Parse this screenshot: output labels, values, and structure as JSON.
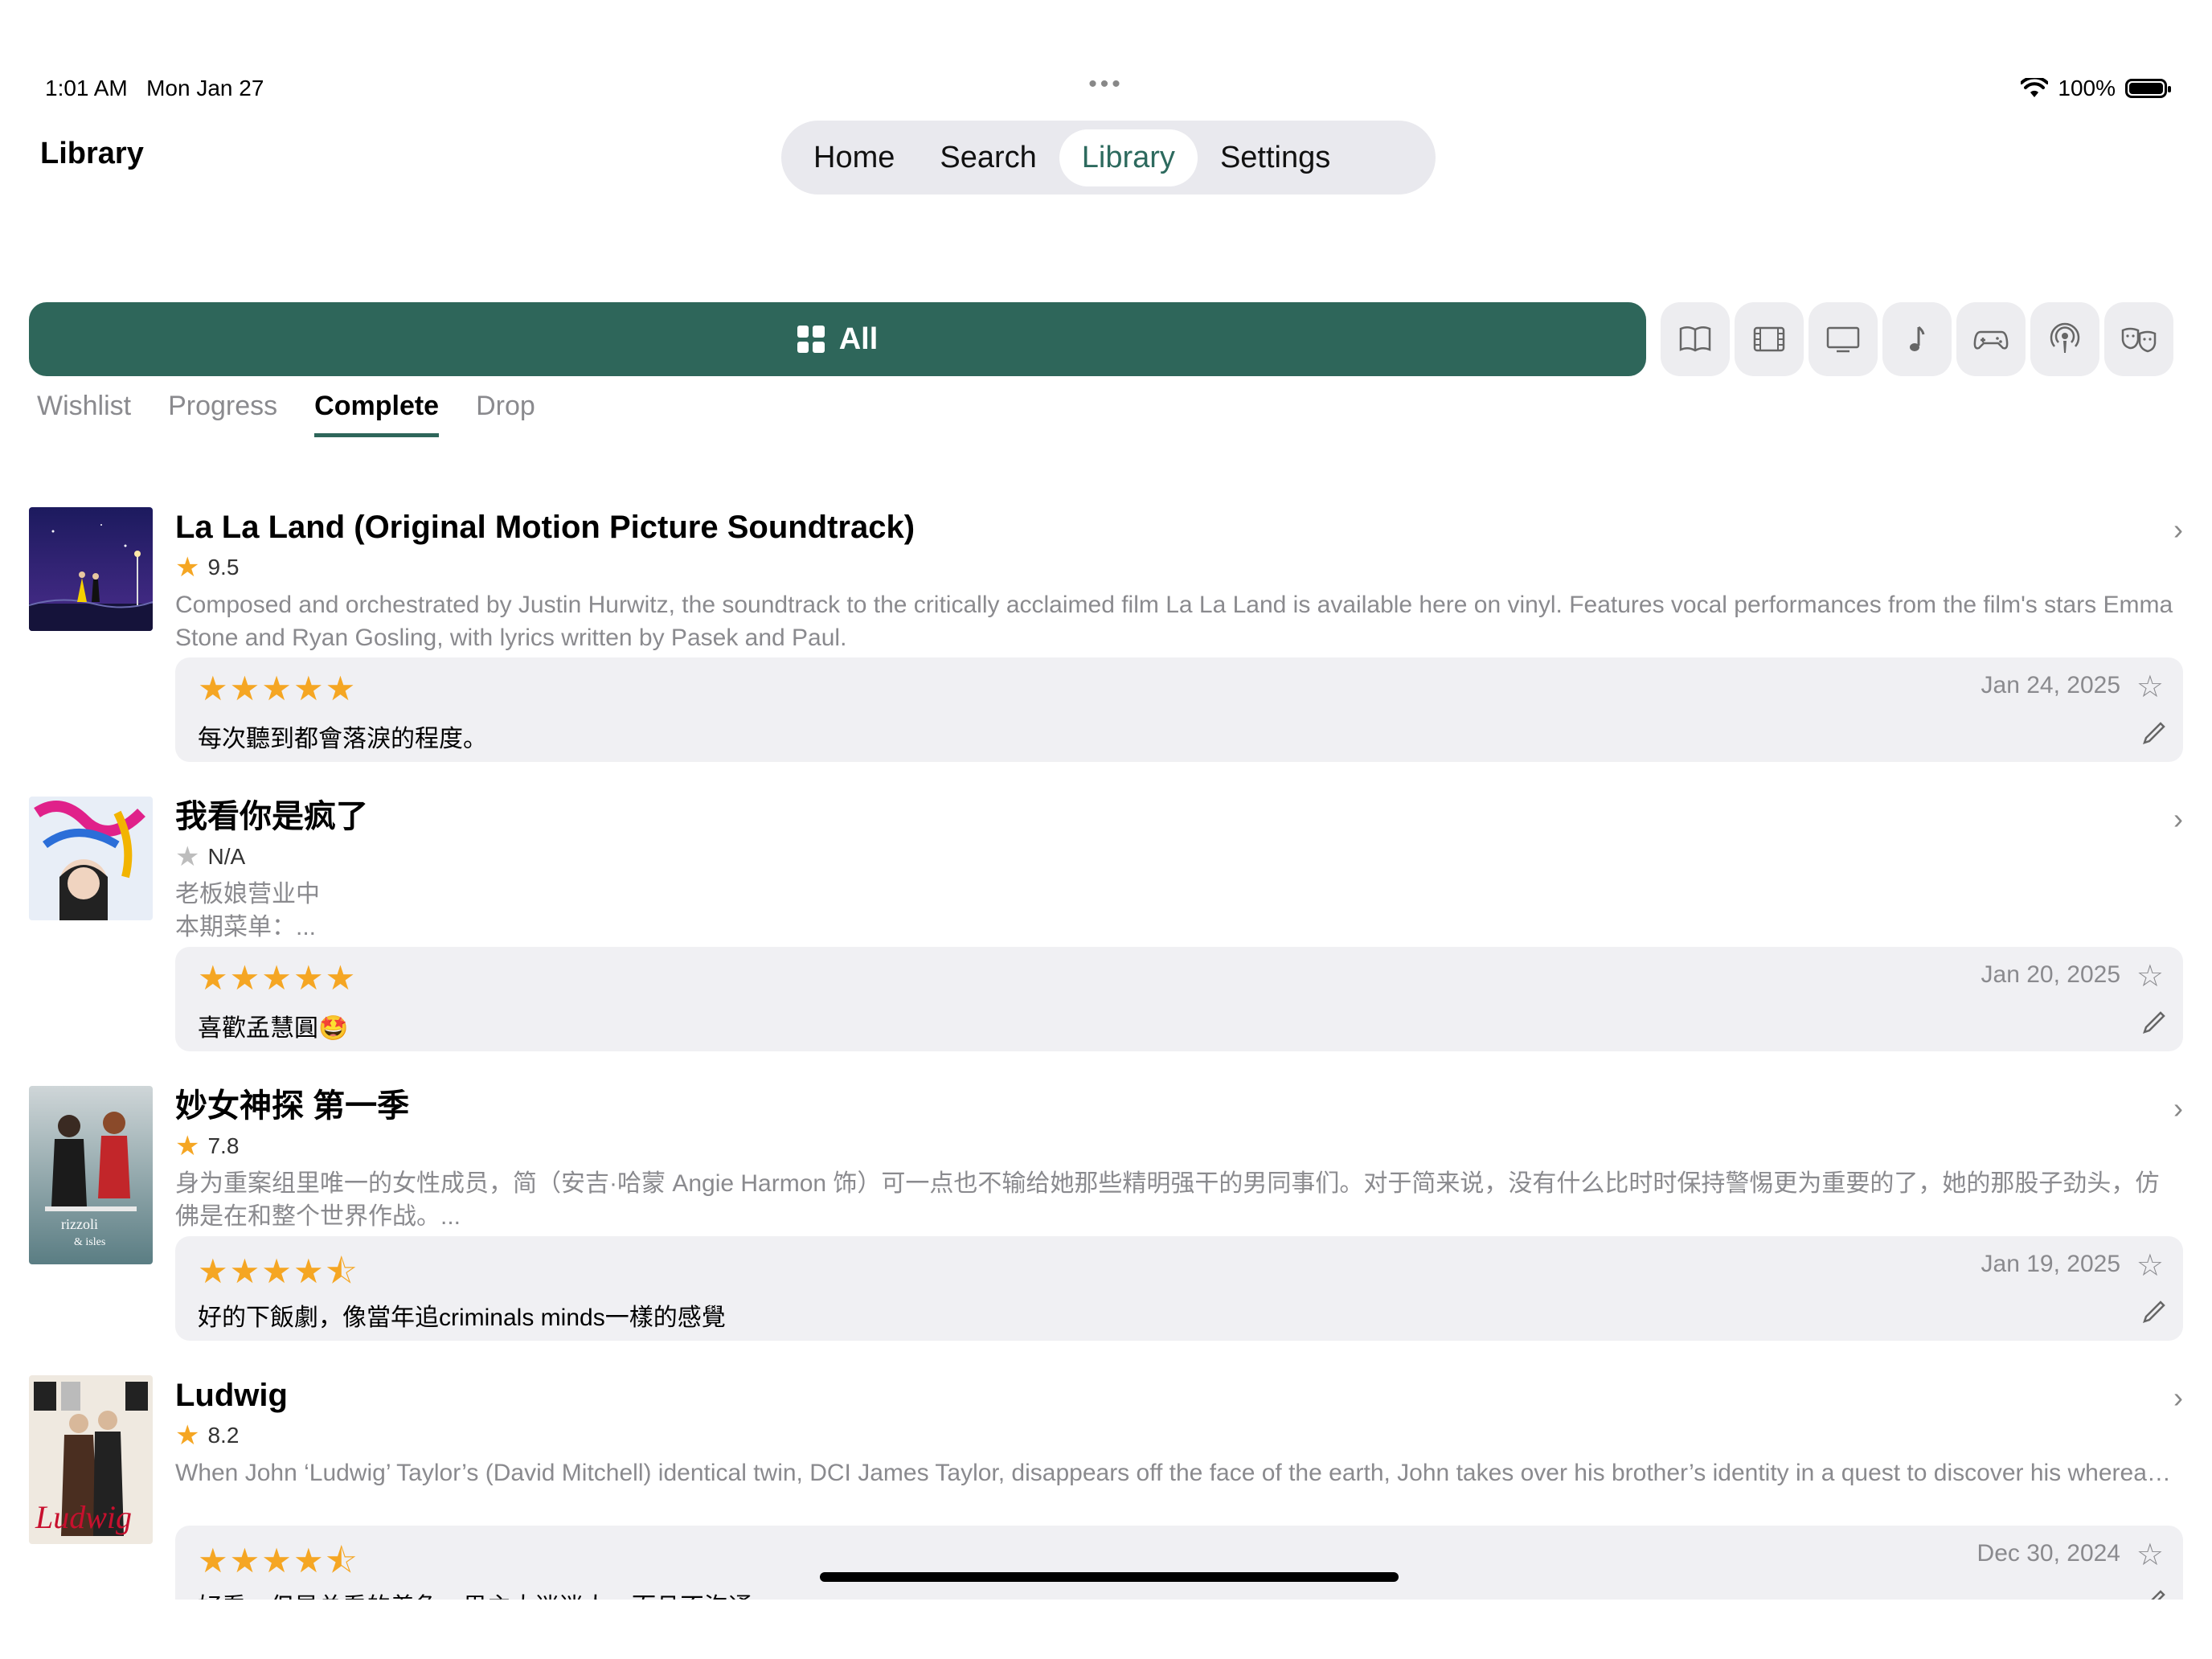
{
  "status_bar": {
    "time": "1:01 AM",
    "date": "Mon Jan 27",
    "battery": "100%",
    "battery_level": 1.0
  },
  "page_title": "Library",
  "tabs": [
    {
      "label": "Home"
    },
    {
      "label": "Search"
    },
    {
      "label": "Library",
      "active": true
    },
    {
      "label": "Settings"
    }
  ],
  "filter": {
    "all_label": "All",
    "accent": "#2e665a"
  },
  "categories": [
    "book-icon",
    "film-icon",
    "tv-icon",
    "music-icon",
    "game-icon",
    "podcast-icon",
    "theater-icon"
  ],
  "subtabs": [
    {
      "label": "Wishlist"
    },
    {
      "label": "Progress"
    },
    {
      "label": "Complete",
      "active": true
    },
    {
      "label": "Drop"
    }
  ],
  "items": [
    {
      "title": "La La Land (Original Motion Picture Soundtrack)",
      "score": "9.5",
      "desc": "Composed and orchestrated by Justin Hurwitz, the soundtrack to the critically acclaimed film La La Land is available here on vinyl. Features vocal performances from the film's stars Emma Stone and Ryan Gosling, with lyrics written by Pasek and Paul.",
      "review_stars": 5,
      "review_date": "Jan 24, 2025",
      "review_text": "每次聽到都會落淚的程度。"
    },
    {
      "title": "我看你是疯了",
      "score": "N/A",
      "desc": "老板娘营业中\n本期菜单：...",
      "review_stars": 5,
      "review_date": "Jan 20, 2025",
      "review_text": "喜歡孟慧圓🤩"
    },
    {
      "title": "妙女神探 第一季",
      "score": "7.8",
      "desc": "身为重案组里唯一的女性成员，简（安吉·哈蒙 Angie Harmon 饰）可一点也不输给她那些精明强干的男同事们。对于简来说，没有什么比时时保持警惕更为重要的了，她的那股子劲头，仿佛是在和整个世界作战。...",
      "review_stars": 4.5,
      "review_date": "Jan 19, 2025",
      "review_text": "好的下飯劇，像當年追criminals minds一樣的感覺"
    },
    {
      "title": "Ludwig",
      "score": "8.2",
      "desc": "When John ‘Ludwig’ Taylor’s (David Mitchell) identical twin, DCI James Taylor, disappears off the face of the earth, John takes over his brother’s identity in a quest to discover his whereabouts. John has never married; never had a family and never really ventured further than his own front door. Without a computer, mobile phone or even a television, he lives i...",
      "review_stars": 4.5,
      "review_date": "Dec 30, 2024",
      "review_text": "好看，但是总看的着急，男主太迷迷人，而且不沟通。"
    }
  ]
}
